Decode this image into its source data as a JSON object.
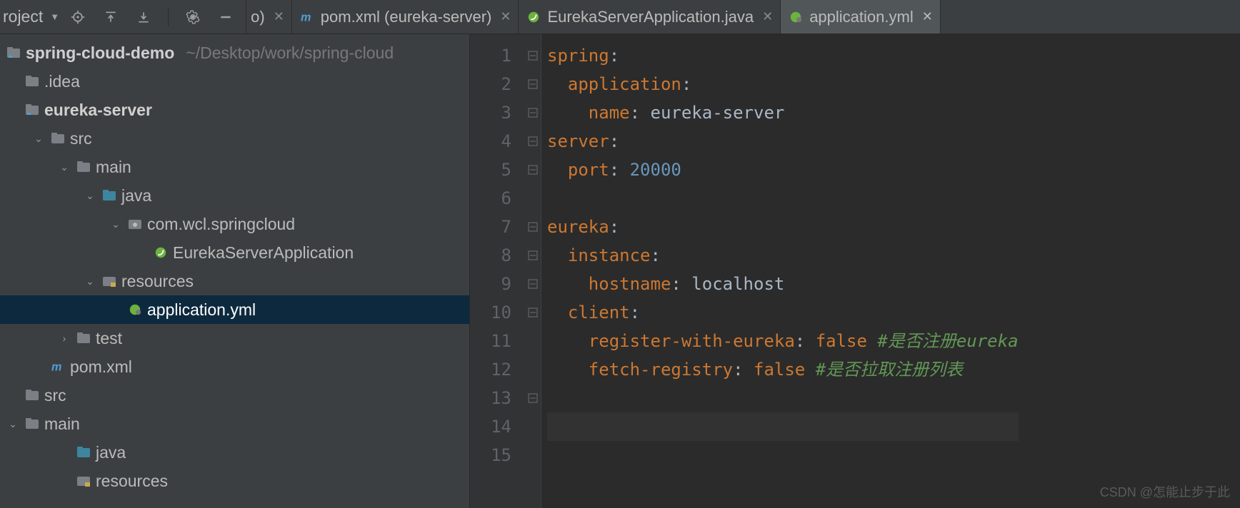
{
  "header": {
    "project_label": "roject",
    "trailing_label": "o)"
  },
  "tabs": [
    {
      "label": "pom.xml (eureka-server)",
      "icon": "m"
    },
    {
      "label": "EurekaServerApplication.java",
      "icon": "spring"
    },
    {
      "label": "application.yml",
      "icon": "yml",
      "active": true
    }
  ],
  "tree": {
    "root_name": "spring-cloud-demo",
    "root_path": "~/Desktop/work/spring-cloud",
    "items": {
      "idea": ".idea",
      "eureka": "eureka-server",
      "src": "src",
      "main": "main",
      "java": "java",
      "pkg": "com.wcl.springcloud",
      "app_class": "EurekaServerApplication",
      "resources": "resources",
      "app_yml": "application.yml",
      "test": "test",
      "pom": "pom.xml",
      "src2": "src",
      "main2": "main",
      "java2": "java",
      "resources2": "resources"
    }
  },
  "editor": {
    "line_numbers": [
      "1",
      "2",
      "3",
      "4",
      "5",
      "6",
      "7",
      "8",
      "9",
      "10",
      "11",
      "12",
      "13",
      "14",
      "15"
    ],
    "code": {
      "l1_key": "spring",
      "l2_key": "application",
      "l3_key": "name",
      "l3_val": "eureka-server",
      "l4_key": "server",
      "l5_key": "port",
      "l5_val": "20000",
      "l7_key": "eureka",
      "l8_key": "instance",
      "l9_key": "hostname",
      "l9_val": "localhost",
      "l10_key": "client",
      "l11_key": "register-with-eureka",
      "l11_val": "false",
      "l11_c": "#是否注册eureka",
      "l12_key": "fetch-registry",
      "l12_val": "false",
      "l12_c": "#是否拉取注册列表"
    }
  },
  "watermark": "CSDN @怎能止步于此"
}
